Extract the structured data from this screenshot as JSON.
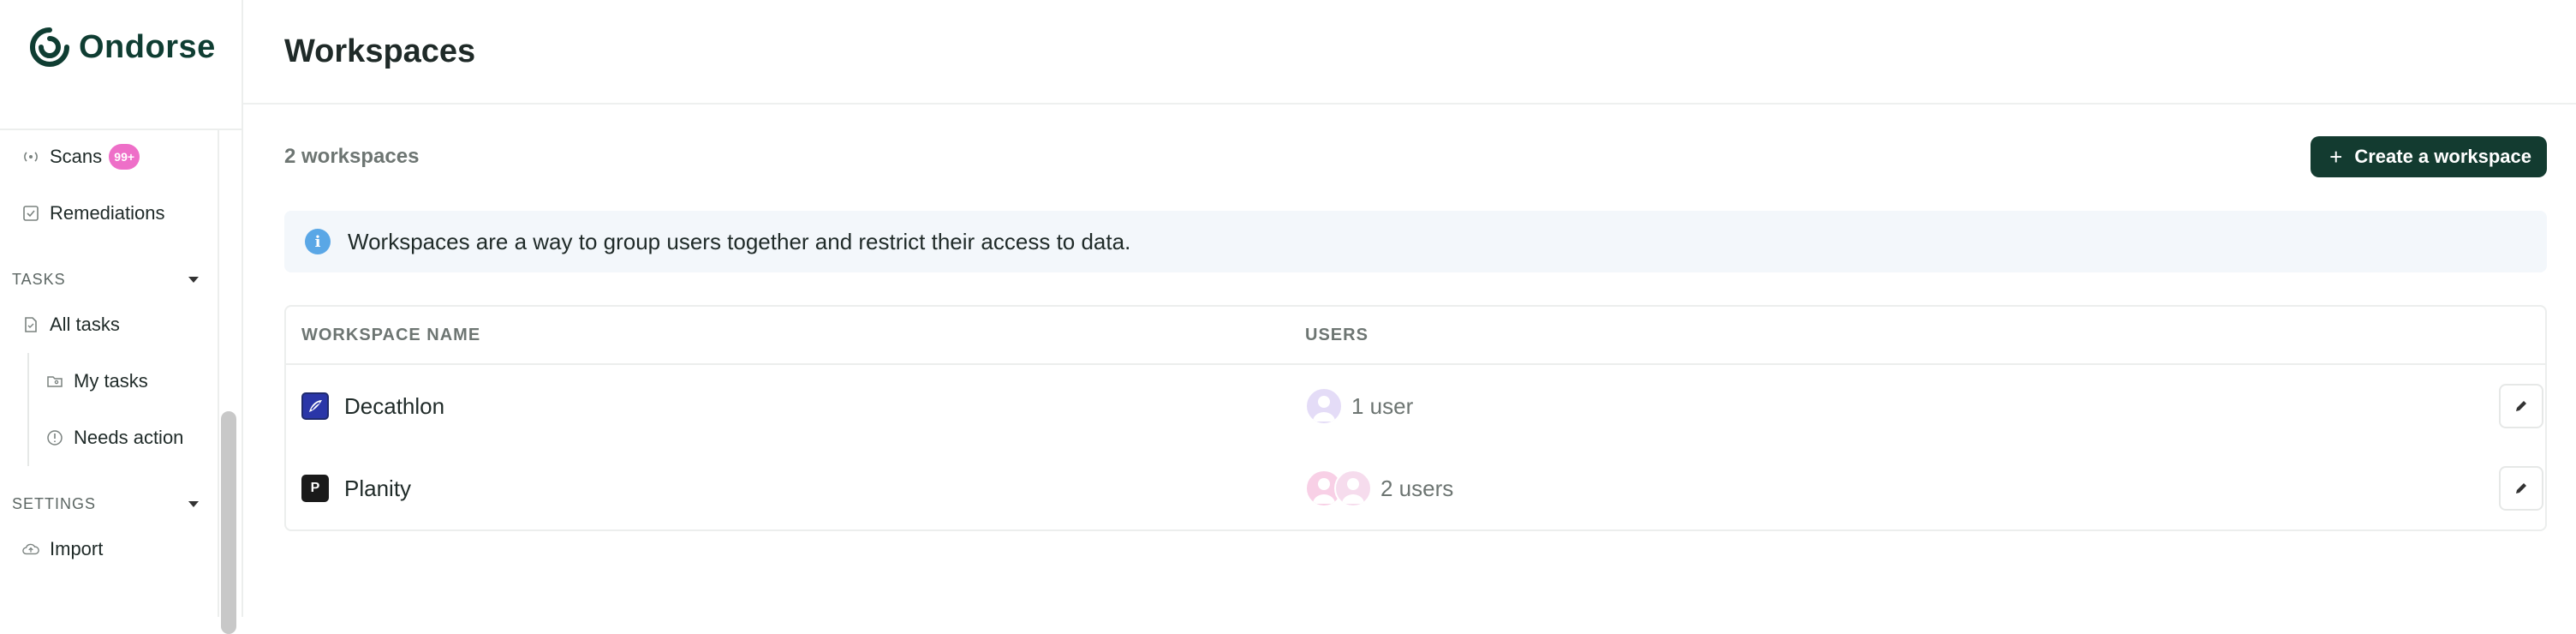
{
  "brand": {
    "name": "Ondorse"
  },
  "sidebar": {
    "items": [
      {
        "label": "Scans",
        "icon": "broadcast-icon",
        "badge": "99+"
      },
      {
        "label": "Remediations",
        "icon": "checkbox-icon"
      }
    ],
    "tasks": {
      "header": "TASKS",
      "items": [
        {
          "label": "All tasks",
          "icon": "document-icon"
        }
      ],
      "sub_items": [
        {
          "label": "My tasks",
          "icon": "folder-user-icon"
        },
        {
          "label": "Needs action",
          "icon": "alert-circle-icon"
        }
      ]
    },
    "settings": {
      "header": "SETTINGS",
      "items": [
        {
          "label": "Import",
          "icon": "cloud-upload-icon"
        }
      ]
    }
  },
  "header": {
    "title": "Workspaces"
  },
  "main": {
    "count_label": "2 workspaces",
    "create_button": "Create a workspace",
    "info_text": "Workspaces are a way to group users together and restrict their access to data.",
    "table": {
      "columns": [
        "WORKSPACE NAME",
        "USERS"
      ],
      "rows": [
        {
          "name": "Decathlon",
          "users": "1 user",
          "logo": "decathlon-logo"
        },
        {
          "name": "Planity",
          "users": "2 users",
          "logo": "planity-logo",
          "logo_letter": "P"
        }
      ]
    }
  },
  "colors": {
    "brand": "#0f3d32",
    "primary_button": "#133b30",
    "badge": "#ee6fc8",
    "info_bg": "#f3f7fb",
    "info_icon": "#5aa7e6"
  }
}
